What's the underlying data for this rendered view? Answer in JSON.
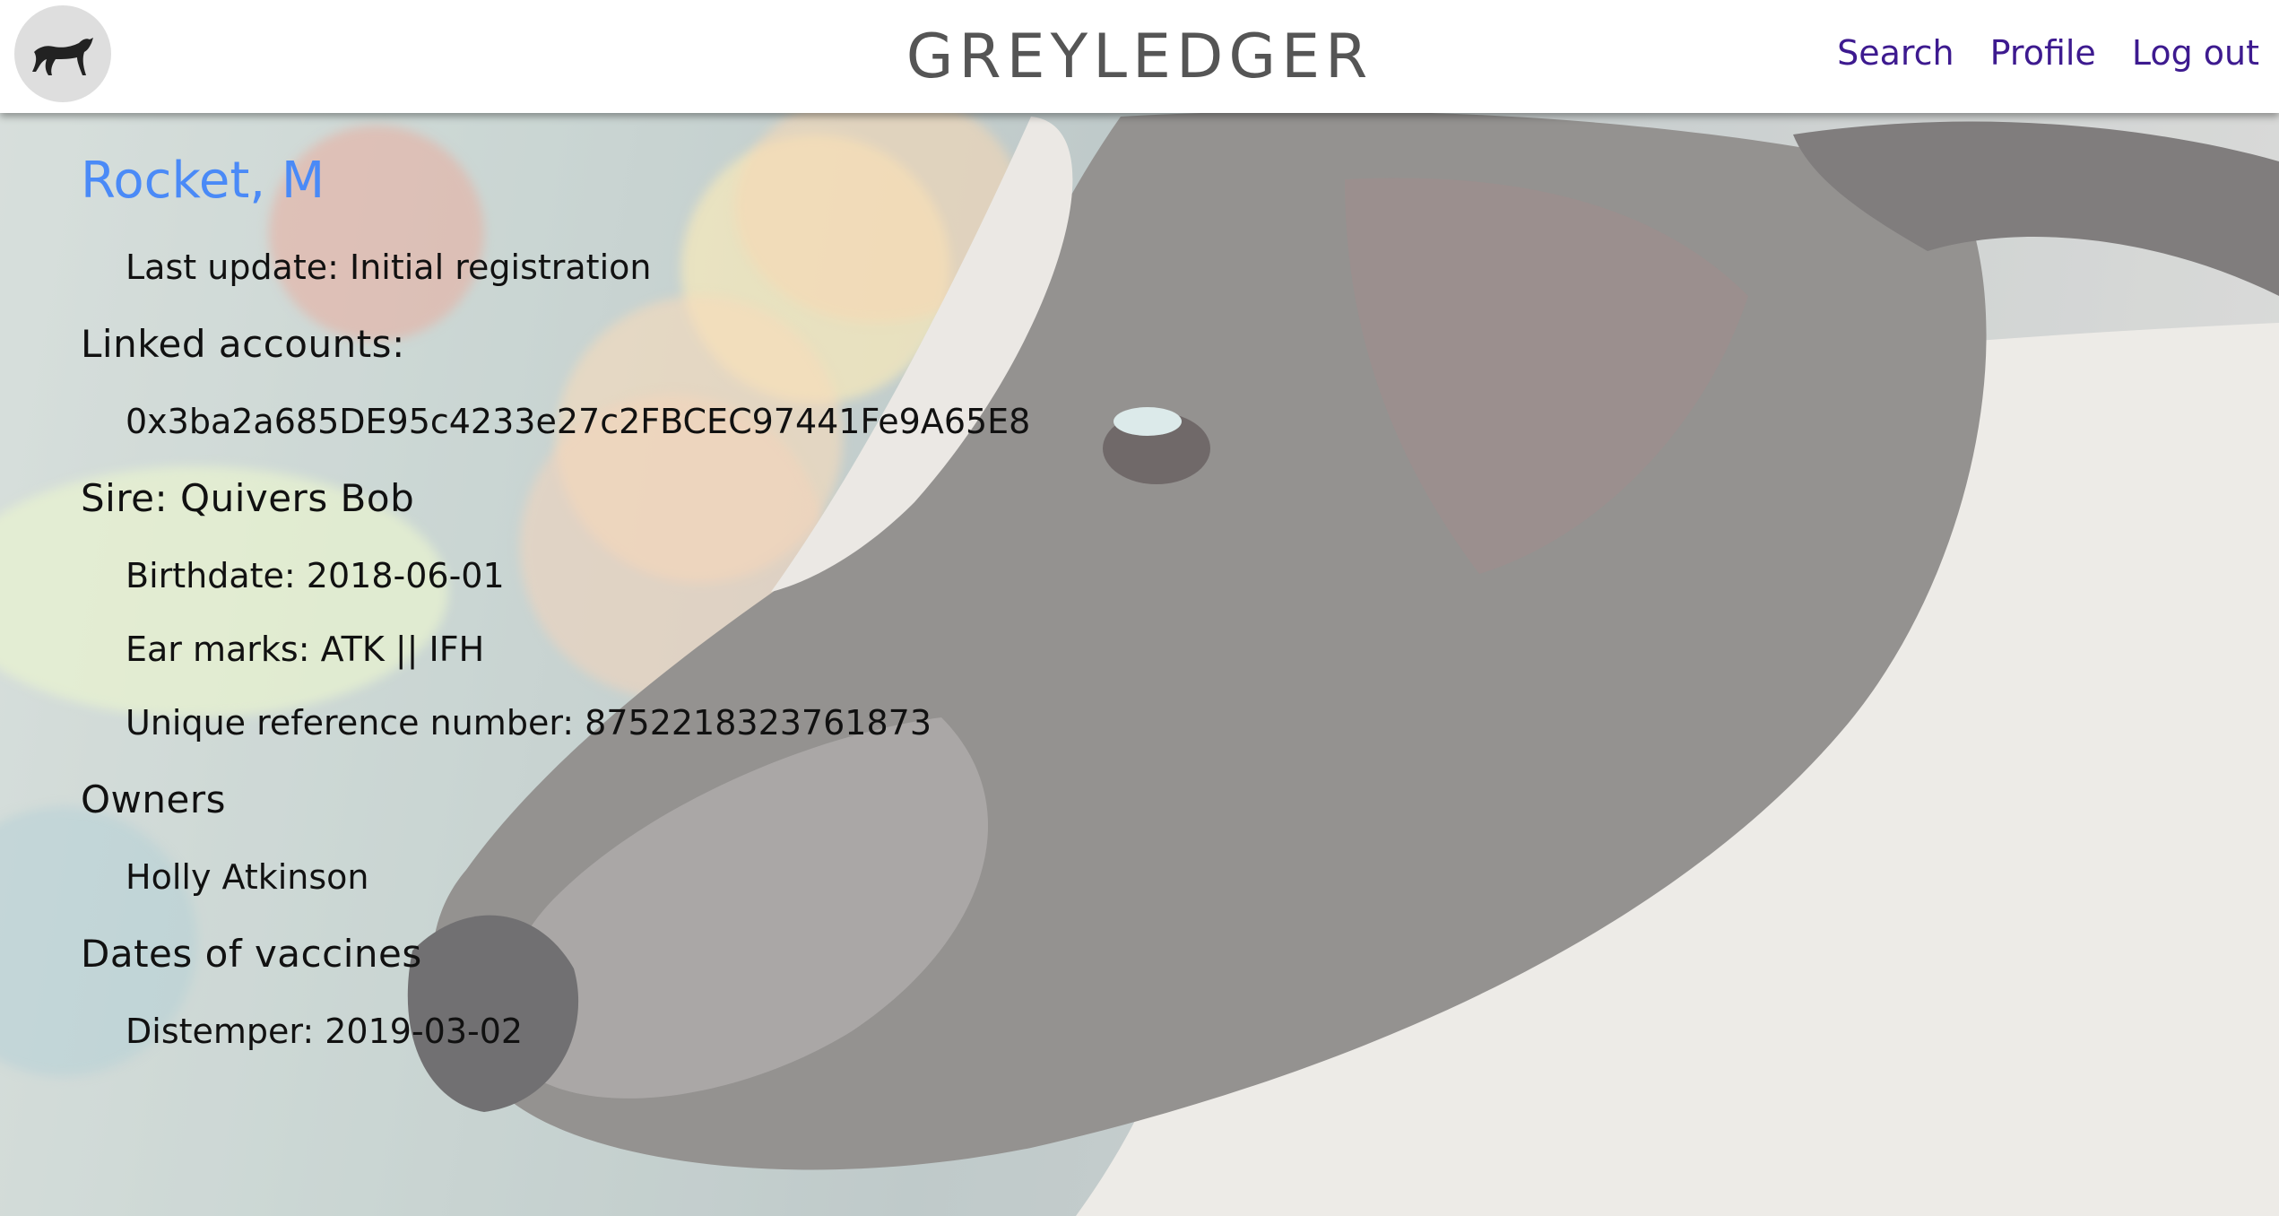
{
  "header": {
    "logo_icon": "greyhound-icon",
    "brand": "GREYLEDGER",
    "nav": {
      "search": "Search",
      "profile": "Profile",
      "logout": "Log out"
    },
    "nav_color": "#3d1a8f"
  },
  "dog": {
    "name": "Rocket, M",
    "name_color": "#4a8af7",
    "last_update": "Last update: Initial registration",
    "linked_accounts_heading": "Linked accounts:",
    "linked_account": "0x3ba2a685DE95c4233e27c2FBCEC97441Fe9A65E8",
    "sire": "Sire: Quivers Bob",
    "birthdate": "Birthdate: 2018-06-01",
    "ear_marks": "Ear marks: ATK || IFH",
    "urn": "Unique reference number: 8752218323761873",
    "owners_heading": "Owners",
    "owner": "Holly Atkinson",
    "vaccines_heading": "Dates of vaccines",
    "vaccine": "Distemper: 2019-03-02"
  }
}
